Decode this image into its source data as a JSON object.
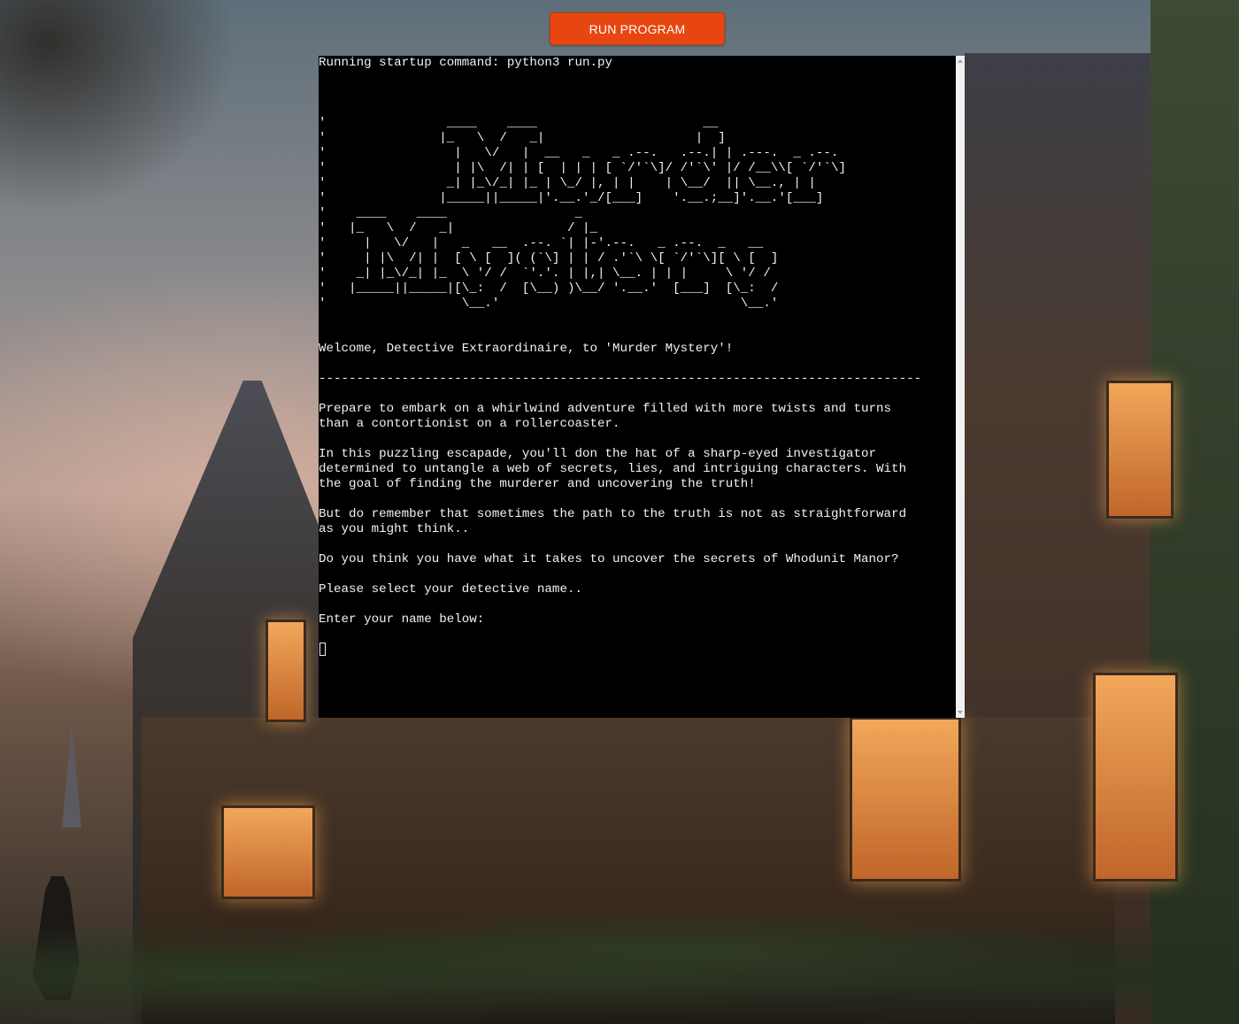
{
  "toolbar": {
    "run_label": "RUN PROGRAM"
  },
  "colors": {
    "button": "#e84610",
    "terminal_bg": "#000000",
    "terminal_text": "#f2f2f2"
  },
  "terminal": {
    "output_lines": [
      "Running startup command: python3 run.py",
      "",
      "",
      "",
      "'                ____    ____                      __",
      "'               |_   \\  /   _|                    |  ]",
      "'                 |   \\/   |  __   _   _ .--.   .--.| | .---.  _ .--.",
      "'                 | |\\  /| | [  | | | [ `/'`\\]/ /'`\\' |/ /__\\\\[ `/'`\\]",
      "'                _| |_\\/_| |_ | \\_/ |, | |    | \\__/  || \\__., | |",
      "'               |_____||_____|'.__.'_/[___]    '.__.;__]'.__.'[___]",
      "'    ____    ____                 _",
      "'   |_   \\  /   _|               / |_",
      "'     |   \\/   |   _   __  .--. `| |-'.--.   _ .--.  _   __",
      "'     | |\\  /| |  [ \\ [  ]( (`\\] | | / .'`\\ \\[ `/'`\\][ \\ [  ]",
      "'    _| |_\\/_| |_  \\ '/ /  `'.'. | |,| \\__. | | |     \\ '/ /",
      "'   |_____||_____|[\\_:  /  [\\__) )\\__/ '.__.'  [___]  [\\_:  /",
      "'                  \\__.'                                \\__.'",
      "",
      "",
      "Welcome, Detective Extraordinaire, to 'Murder Mystery'!",
      "",
      "--------------------------------------------------------------------------------",
      "",
      "Prepare to embark on a whirlwind adventure filled with more twists and turns",
      "than a contortionist on a rollercoaster.",
      "",
      "In this puzzling escapade, you'll don the hat of a sharp-eyed investigator",
      "determined to untangle a web of secrets, lies, and intriguing characters. With",
      "the goal of finding the murderer and uncovering the truth!",
      "",
      "But do remember that sometimes the path to the truth is not as straightforward",
      "as you might think..",
      "",
      "Do you think you have what it takes to uncover the secrets of Whodunit Manor?",
      "",
      "Please select your detective name..",
      "",
      "Enter your name below:"
    ]
  }
}
